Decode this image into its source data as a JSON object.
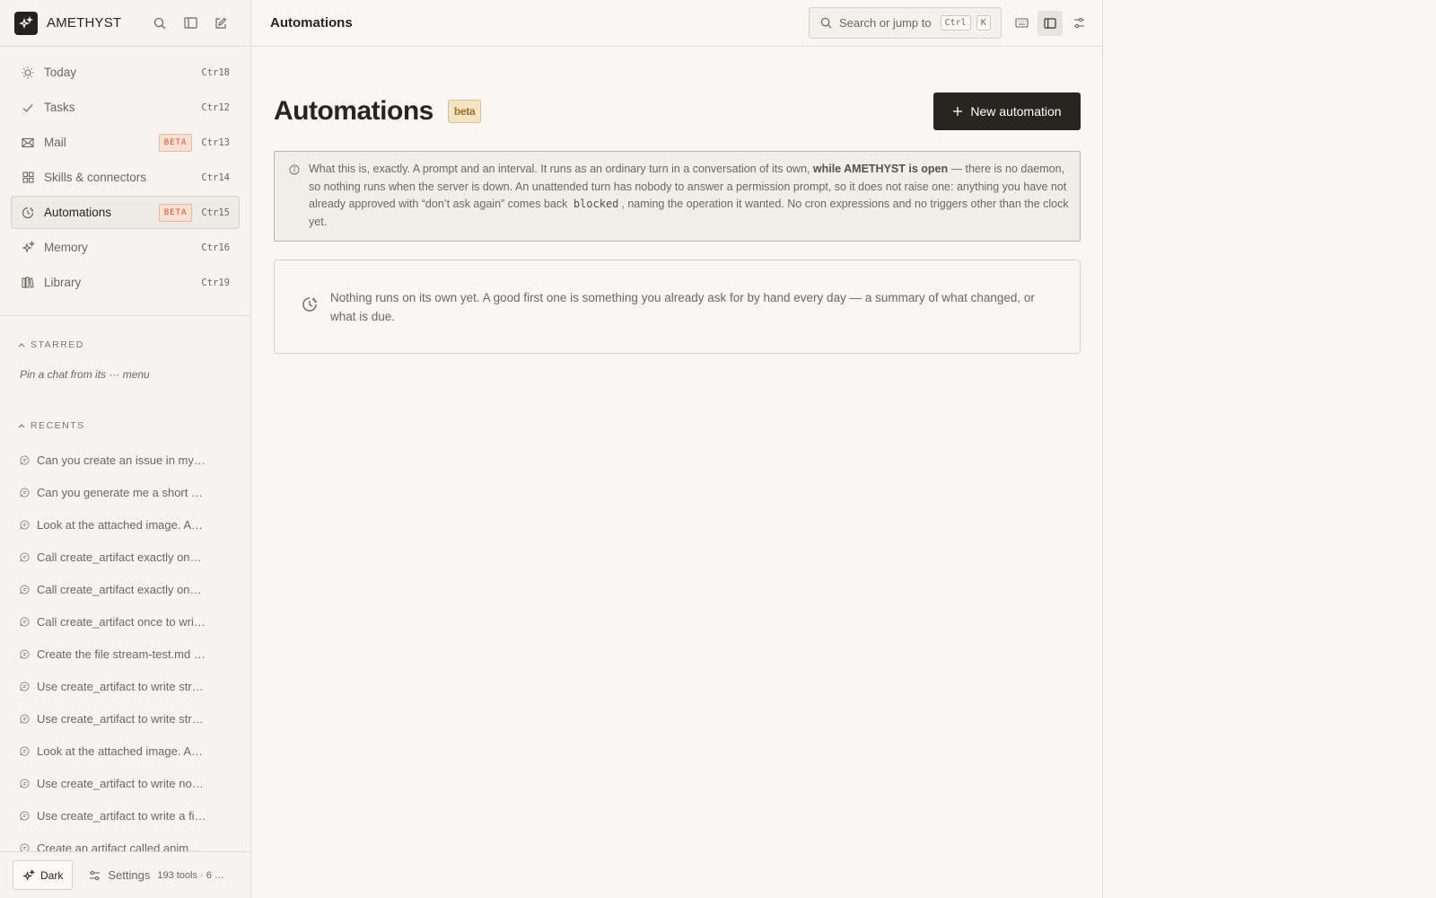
{
  "app": {
    "name": "AMETHYST"
  },
  "sidebar": {
    "nav": [
      {
        "label": "Today",
        "shortcut": "Ctr18",
        "icon": "sun-icon",
        "badge": ""
      },
      {
        "label": "Tasks",
        "shortcut": "Ctr12",
        "icon": "check-icon",
        "badge": ""
      },
      {
        "label": "Mail",
        "shortcut": "Ctr13",
        "icon": "mail-icon",
        "badge": "BETA"
      },
      {
        "label": "Skills & connectors",
        "shortcut": "Ctr14",
        "icon": "grid-icon",
        "badge": ""
      },
      {
        "label": "Automations",
        "shortcut": "Ctr15",
        "icon": "clock-icon",
        "badge": "BETA",
        "active": true
      },
      {
        "label": "Memory",
        "shortcut": "Ctr16",
        "icon": "sparkle-icon",
        "badge": ""
      },
      {
        "label": "Library",
        "shortcut": "Ctr19",
        "icon": "books-icon",
        "badge": ""
      }
    ],
    "starred": {
      "heading": "STARRED",
      "empty_text": "Pin a chat from its ··· menu"
    },
    "recents": {
      "heading": "RECENTS",
      "items": [
        "Can you create an issue in my…",
        "Can you generate me a short …",
        "Look at the attached image. A…",
        "Call create_artifact exactly on…",
        "Call create_artifact exactly on…",
        "Call create_artifact once to wri…",
        "Create the file stream-test.md …",
        "Use create_artifact to write str…",
        "Use create_artifact to write str…",
        "Look at the attached image. A…",
        "Use create_artifact to write no…",
        "Use create_artifact to write a fi…",
        "Create an artifact called anim…"
      ]
    },
    "footer": {
      "theme_label": "Dark",
      "settings_label": "Settings",
      "tools_summary": "193 tools · 6 …"
    }
  },
  "topbar": {
    "title": "Automations",
    "search_placeholder": "Search or jump to",
    "search_kbd_1": "Ctrl",
    "search_kbd_2": "K"
  },
  "page": {
    "title": "Automations",
    "beta_label": "beta",
    "new_button_label": "New automation",
    "info": {
      "lead": "What this is, exactly. A prompt and an interval. It runs as an ordinary turn in a conversation of its own, ",
      "bold": "while AMETHYST is open",
      "mid": " — there is no daemon, so nothing runs when the server is down. An unattended turn has nobody to answer a permission prompt, so it does not raise one: anything you have not already approved with “don’t ask again” comes back ",
      "code": "blocked",
      "tail": ", naming the operation it wanted. No cron expressions and no triggers other than the clock yet."
    },
    "empty_state": "Nothing runs on its own yet. A good first one is something you already ask for by hand every day — a summary of what changed, or what is due."
  },
  "colors": {
    "background": "#f8f7f3",
    "primary_button": "#26251f",
    "beta_badge_text": "#d2562b",
    "beta_pill_text": "#a27026"
  }
}
